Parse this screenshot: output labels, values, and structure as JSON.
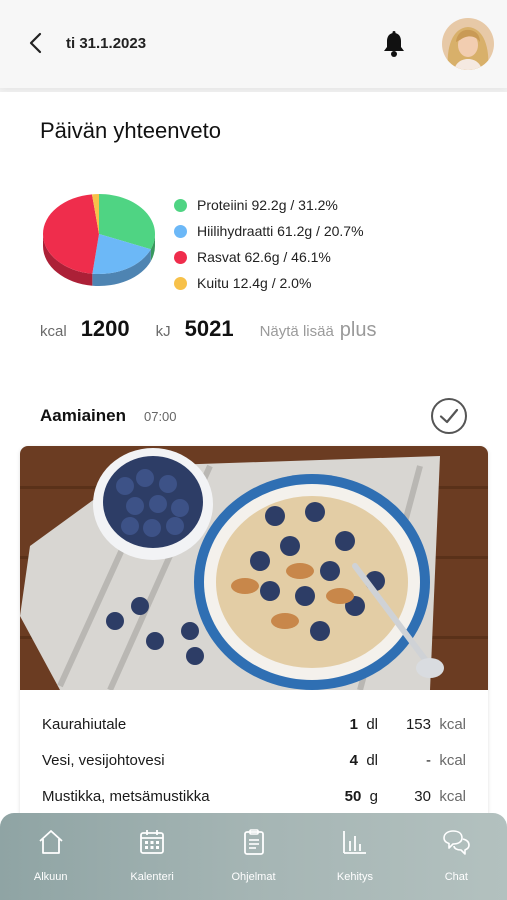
{
  "header": {
    "back_icon": "chevron-left-icon",
    "date": "ti 31.1.2023",
    "bell_icon": "bell-icon"
  },
  "summary": {
    "title": "Päivän yhteenveto",
    "legend": [
      {
        "label": "Proteiini 92.2g / 31.2%",
        "color": "#4fd483"
      },
      {
        "label": "Hiilihydraatti 61.2g / 20.7%",
        "color": "#6cb8f7"
      },
      {
        "label": "Rasvat 62.6g / 46.1%",
        "color": "#ef2d4c"
      },
      {
        "label": "Kuitu 12.4g / 2.0%",
        "color": "#f7c14a"
      }
    ],
    "kcal_label": "kcal",
    "kcal_value": "1200",
    "kj_label": "kJ",
    "kj_value": "5021",
    "more_label": "Näytä lisää",
    "more_icon": "plus"
  },
  "chart_data": {
    "type": "pie",
    "categories": [
      "Proteiini",
      "Hiilihydraatti",
      "Rasvat",
      "Kuitu"
    ],
    "values": [
      31.2,
      20.7,
      46.1,
      2.0
    ],
    "colors": [
      "#4fd483",
      "#6cb8f7",
      "#ef2d4c",
      "#f7c14a"
    ]
  },
  "meal": {
    "name": "Aamiainen",
    "time": "07:00",
    "check_icon": "check-circle-icon",
    "items": [
      {
        "name": "Kaurahiutale",
        "qty": "1",
        "unit": "dl",
        "kcal": "153",
        "kcal_unit": "kcal"
      },
      {
        "name": "Vesi, vesijohtovesi",
        "qty": "4",
        "unit": "dl",
        "kcal": "-",
        "kcal_unit": "kcal"
      },
      {
        "name": "Mustikka, metsämustikka",
        "qty": "50",
        "unit": "g",
        "kcal": "30",
        "kcal_unit": "kcal"
      }
    ]
  },
  "nav": {
    "items": [
      {
        "label": "Alkuun",
        "icon": "home-icon"
      },
      {
        "label": "Kalenteri",
        "icon": "calendar-icon"
      },
      {
        "label": "Ohjelmat",
        "icon": "clipboard-icon"
      },
      {
        "label": "Kehitys",
        "icon": "bar-chart-icon"
      },
      {
        "label": "Chat",
        "icon": "chat-bubbles-icon"
      }
    ]
  }
}
